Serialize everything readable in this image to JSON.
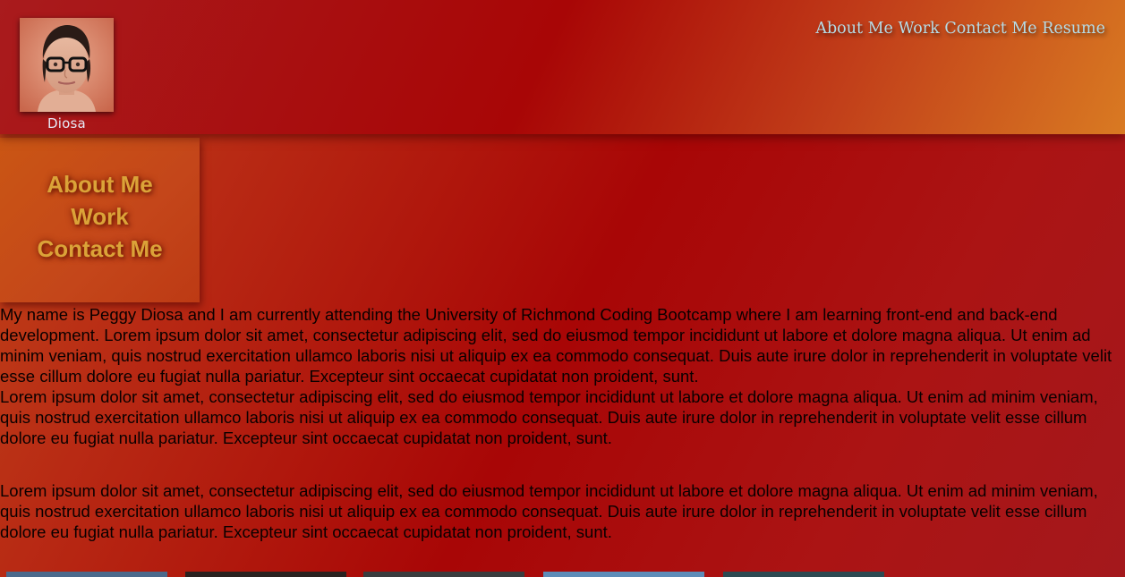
{
  "header": {
    "avatar_name": "Diosa",
    "nav": [
      {
        "label": "About Me"
      },
      {
        "label": "Work"
      },
      {
        "label": "Contact Me"
      },
      {
        "label": "Resume"
      }
    ]
  },
  "sidebar": {
    "items": [
      {
        "label": "About Me"
      },
      {
        "label": "Work"
      },
      {
        "label": "Contact Me"
      }
    ]
  },
  "main": {
    "paragraphs": [
      "My name is Peggy Diosa and I am currently attending the University of Richmond Coding Bootcamp where I am learning front-end and back-end development. Lorem ipsum dolor sit amet, consectetur adipiscing elit, sed do eiusmod tempor incididunt ut labore et dolore magna aliqua. Ut enim ad minim veniam, quis nostrud exercitation ullamco laboris nisi ut aliquip ex ea commodo consequat. Duis aute irure dolor in reprehenderit in voluptate velit esse cillum dolore eu fugiat nulla pariatur. Excepteur sint occaecat cupidatat non proident, sunt.",
      "Lorem ipsum dolor sit amet, consectetur adipiscing elit, sed do eiusmod tempor incididunt ut labore et dolore magna aliqua. Ut enim ad minim veniam, quis nostrud exercitation ullamco laboris nisi ut aliquip ex ea commodo consequat. Duis aute irure dolor in reprehenderit in voluptate velit esse cillum dolore eu fugiat nulla pariatur. Excepteur sint occaecat cupidatat non proident, sunt.",
      "Lorem ipsum dolor sit amet, consectetur adipiscing elit, sed do eiusmod tempor incididunt ut labore et dolore magna aliqua. Ut enim ad minim veniam, quis nostrud exercitation ullamco laboris nisi ut aliquip ex ea commodo consequat. Duis aute irure dolor in reprehenderit in voluptate velit esse cillum dolore eu fugiat nulla pariatur. Excepteur sint occaecat cupidatat non proident, sunt."
    ]
  },
  "colors": {
    "header_nav": "#b5dbe6",
    "sidebar_link": "#dba338",
    "accent_red": "#a80606",
    "accent_orange": "#d97a22"
  },
  "work_thumbnails": [
    {
      "color": "#4b6a8c"
    },
    {
      "color": "#2a2220"
    },
    {
      "color": "#3a3c3e"
    },
    {
      "color": "#5d8cb8"
    },
    {
      "color": "#2d4a52"
    }
  ]
}
